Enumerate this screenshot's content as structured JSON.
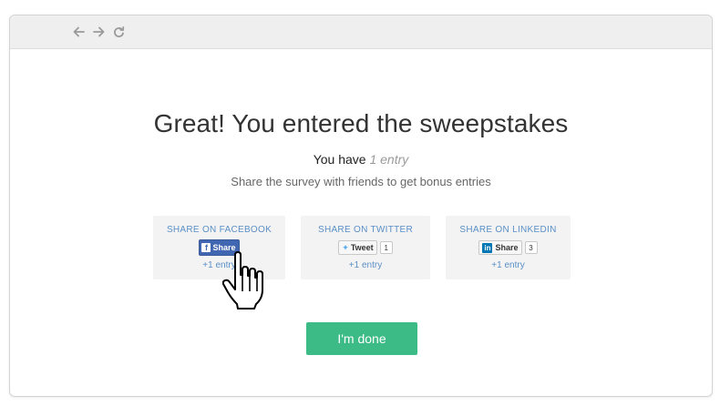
{
  "browser": {
    "back_icon": "arrow-left-icon",
    "forward_icon": "arrow-right-icon",
    "refresh_icon": "refresh-icon"
  },
  "page": {
    "title": "Great! You entered the sweepstakes",
    "entries_prefix": "You have",
    "entries_count": "1 entry",
    "subtitle": "Share the survey with friends to get bonus entries"
  },
  "share": {
    "facebook": {
      "title": "SHARE ON FACEBOOK",
      "button": "Share",
      "entry": "+1 entry"
    },
    "twitter": {
      "title": "SHARE ON TWITTER",
      "button": "Tweet",
      "count": "1",
      "entry": "+1 entry"
    },
    "linkedin": {
      "title": "SHARE ON LINKEDIN",
      "button": "Share",
      "count": "3",
      "entry": "+1 entry"
    }
  },
  "done_button": "I'm done",
  "colors": {
    "accent_green": "#3dbb87",
    "link_blue": "#5a8fc7",
    "facebook_blue": "#4267b2",
    "linkedin_blue": "#0077b5",
    "twitter_blue": "#55acee"
  }
}
